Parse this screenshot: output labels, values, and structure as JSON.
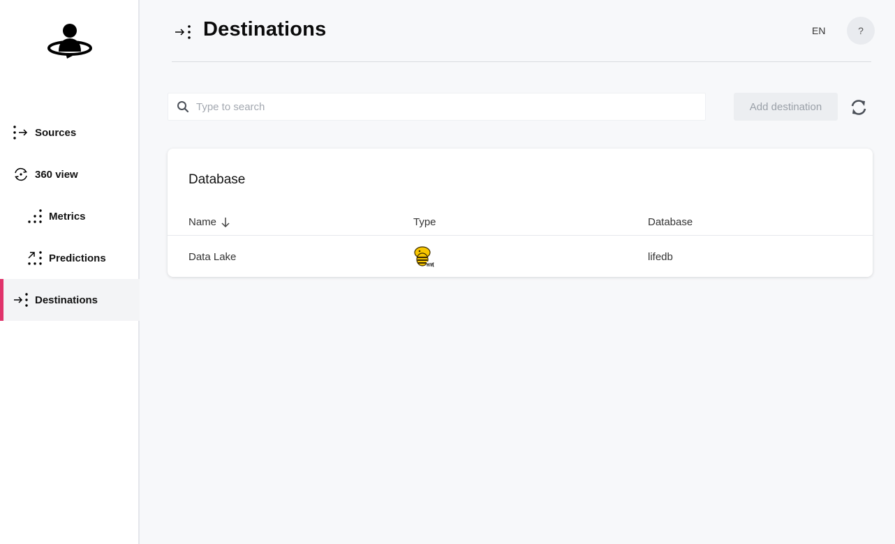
{
  "sidebar": {
    "items": [
      {
        "label": "Sources",
        "icon": "sources-icon"
      },
      {
        "label": "360 view",
        "icon": "view-360-icon"
      },
      {
        "label": "Metrics",
        "icon": "metrics-icon"
      },
      {
        "label": "Predictions",
        "icon": "predictions-icon"
      },
      {
        "label": "Destinations",
        "icon": "destinations-icon",
        "active": true
      }
    ]
  },
  "header": {
    "title": "Destinations",
    "language": "EN",
    "help": "?"
  },
  "toolbar": {
    "search_placeholder": "Type to search",
    "add_label": "Add destination"
  },
  "card": {
    "title": "Database",
    "columns": [
      "Name",
      "Type",
      "Database"
    ],
    "rows": [
      {
        "name": "Data Lake",
        "type": "hive-logo",
        "database": "lifedb"
      }
    ]
  },
  "colors": {
    "accent": "#e0336b",
    "background": "#f7f8fa",
    "hive_yellow": "#f7c600"
  }
}
